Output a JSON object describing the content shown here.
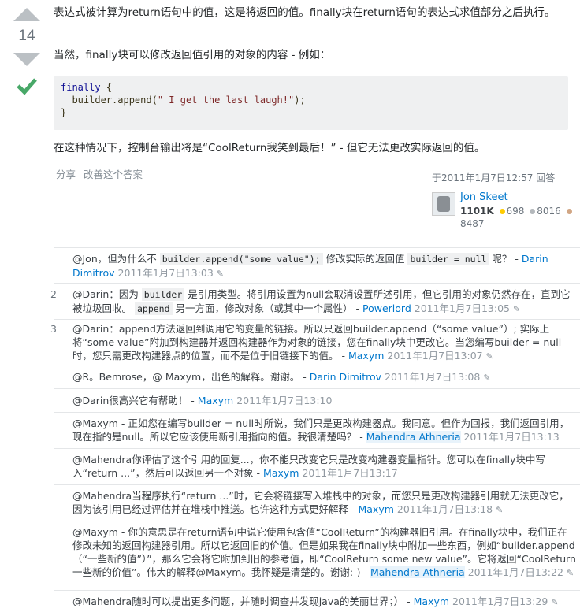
{
  "vote": {
    "count": "14"
  },
  "answer": {
    "p1": "表达式被计算为return语句中的值，这是将返回的值。finally块在return语句的表达式求值部分之后执行。",
    "p2": "当然，finally块可以修改返回值引用的对象的内容 - 例如：",
    "code": {
      "line1_kw": "finally",
      "line1_rest": " {",
      "line2_pre": "  builder.append(",
      "line2_str": "\" I get the last laugh!\"",
      "line2_post": ");",
      "line3": "}"
    },
    "p3": "在这种情况下，控制台输出将是“CoolReturn我笑到最后！” - 但它无法更改实际返回的值。",
    "actions": {
      "share": "分享",
      "edit": "改善这个答案"
    },
    "signature": {
      "time": "于2011年1月7日12:57 回答",
      "user": "Jon Skeet",
      "rep": "1101K",
      "gold": "698",
      "silver": "8016",
      "bronze": "8487",
      "gold_color": "#ffcc01",
      "silver_color": "#b4b8bc",
      "bronze_color": "#d1a684"
    }
  },
  "comments": [
    {
      "score": "",
      "pre": "@Jon，但为什么不 ",
      "code1": "builder.append(\"some value\");",
      "mid": " 修改实际的返回值 ",
      "code2": "builder = null",
      "post": " 呢？ -",
      "user": "Darin Dimitrov",
      "time": "2011年1月7日13:03"
    },
    {
      "score": "2",
      "pre": "@Darin：因为 ",
      "code1": "builder",
      "mid": " 是引用类型。将引用设置为null会取消设置所述引用，但它引用的对象仍然存在，直到它被垃圾回收。 ",
      "code2": "append",
      "post": " 另一方面，修改对象（或其中一个属性） -",
      "user": "Powerlord",
      "time": "2011年1月7日13:05"
    },
    {
      "score": "3",
      "text": "@Darin：append方法返回到调用它的变量的链接。所以只返回builder.append（“some value”）; 实际上将“some value”附加到构建器并返回构建器作为对象的链接，您在finally块中更改它。当您编写builder = null时，您只需更改构建器点的位置，而不是位于旧链接下的值。 -",
      "user": "Maxym",
      "time": "2011年1月7日13:07"
    },
    {
      "score": "",
      "text": "@R。Bemrose，@ Maxym，出色的解释。谢谢。 -",
      "user": "Darin Dimitrov",
      "time": "2011年1月7日13:08"
    },
    {
      "score": "",
      "text": "@Darin很高兴它有帮助！ -",
      "user": "Maxym",
      "time": "2011年1月7日13:10"
    },
    {
      "score": "",
      "text": "@Maxym - 正如您在编写builder = null时所说，我们只是更改构建器点。我同意。但作为回报，我们返回引用，现在指的是null。所以它应该使用新引用指向的值。我很清楚吗？ -",
      "user": "Mahendra Athneria",
      "time": "2011年1月7日13:13"
    },
    {
      "score": "",
      "text": "@Mahendra你评估了这个引用的回复...，你不能只改变它只是改变构建器变量指针。您可以在finally块中写入“return ...”，然后可以返回另一个对象 -",
      "user": "Maxym",
      "time": "2011年1月7日13:17"
    },
    {
      "score": "",
      "text": "@Mahendra当程序执行“return ...”时，它会将链接写入堆栈中的对象，而您只是更改构建器引用就无法更改它，因为该引用已经过评估并在堆栈中推送。也许这种方式更好解释 -",
      "user": "Maxym",
      "time": "2011年1月7日13:18"
    },
    {
      "score": "",
      "text": "@Maxym - 你的意思是在return语句中说它使用包含值“CoolReturn”的构建器旧引用。在finally块中，我们正在修改未知的返回构建器引用。所以它返回旧的价值。但是如果我在finally块中附加一些东西，例如“builder.append（“一些新的值”）”，那么它会将它附加到旧的参考值，即“CoolReturn some new value”。它将返回“CoolReturn一些新的价值”。伟大的解释@Maxym。我怀疑是清楚的。谢谢:-) -",
      "user": "Mahendra Athneria",
      "time": "2011年1月7日13:22"
    },
    {
      "score": "",
      "text": "@Mahendra随时可以提出更多问题，并随时调查并发现java的美丽世界；） -",
      "user": "Maxym",
      "time": "2011年1月7日13:29"
    }
  ]
}
